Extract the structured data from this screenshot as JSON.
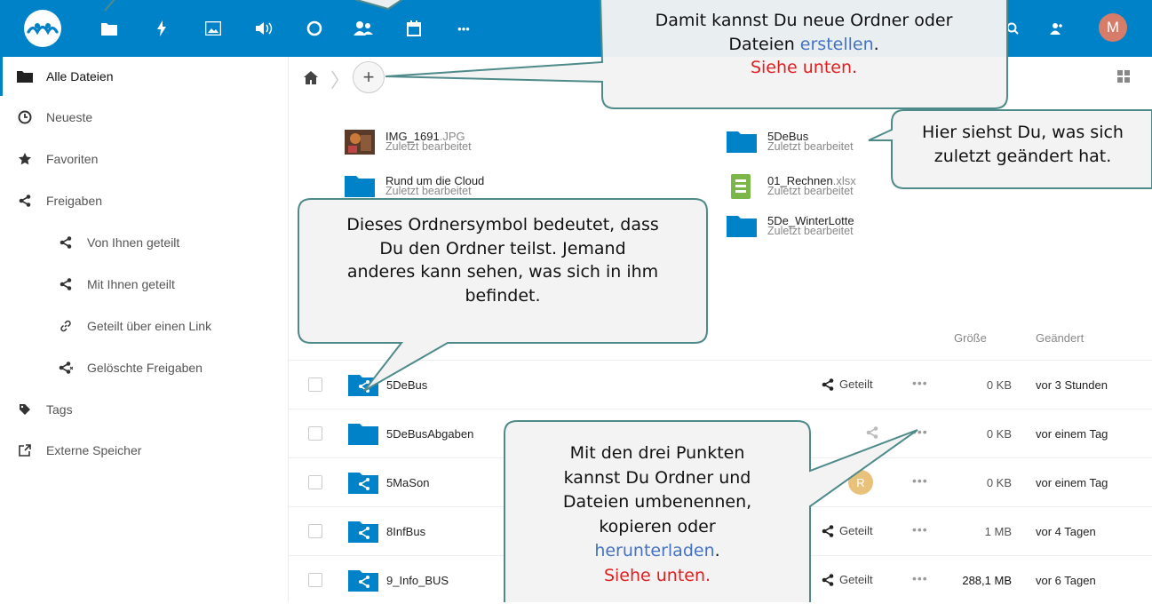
{
  "header": {
    "avatar_letter": "M",
    "brand_color": "#0082c9",
    "apps": [
      "files-icon",
      "activity-icon",
      "photos-icon",
      "audio-icon",
      "talk-icon",
      "contacts-icon",
      "calendar-icon",
      "more-apps-icon"
    ],
    "right_icons": [
      "search-icon",
      "contacts-menu-icon"
    ]
  },
  "sidebar": {
    "items": [
      {
        "label": "Alle Dateien",
        "icon": "folder-icon",
        "active": true
      },
      {
        "label": "Neueste",
        "icon": "clock-icon"
      },
      {
        "label": "Favoriten",
        "icon": "star-icon"
      },
      {
        "label": "Freigaben",
        "icon": "share-icon"
      },
      {
        "label": "Von Ihnen geteilt",
        "icon": "share-icon",
        "sub": true
      },
      {
        "label": "Mit Ihnen geteilt",
        "icon": "share-icon",
        "sub": true
      },
      {
        "label": "Geteilt über einen Link",
        "icon": "link-icon",
        "sub": true
      },
      {
        "label": "Gelöschte Freigaben",
        "icon": "share-deleted-icon",
        "sub": true
      },
      {
        "label": "Tags",
        "icon": "tag-icon"
      },
      {
        "label": "Externe Speicher",
        "icon": "external-icon"
      }
    ]
  },
  "recent": {
    "items": [
      {
        "name": "IMG_1691",
        "ext": ".JPG",
        "sub": "Zuletzt bearbeitet",
        "icon": "image-thumb-icon"
      },
      {
        "name": "Rund um die Cloud",
        "ext": "",
        "sub": "Zuletzt bearbeitet",
        "icon": "folder-icon"
      },
      {
        "name": "5DeBus",
        "ext": "",
        "sub": "Zuletzt bearbeitet",
        "icon": "folder-icon"
      },
      {
        "name": "01_Rechnen",
        "ext": ".xlsx",
        "sub": "Zuletzt bearbeitet",
        "icon": "spreadsheet-icon"
      },
      {
        "name": "5De_WinterLotte",
        "ext": "",
        "sub": "Zuletzt bearbeitet",
        "icon": "folder-icon"
      }
    ]
  },
  "columns": {
    "size": "Größe",
    "modified": "Geändert"
  },
  "files": [
    {
      "name": "5DeBus",
      "share": "Geteilt",
      "size": "0 KB",
      "modified": "vor 3 Stunden",
      "shared": true
    },
    {
      "name": "5DeBusAbgaben",
      "share": "",
      "size": "0 KB",
      "modified": "vor einem Tag",
      "shared": false
    },
    {
      "name": "5MaSon",
      "share": "",
      "size": "0 KB",
      "modified": "vor einem Tag",
      "shared": true,
      "avatar": "R"
    },
    {
      "name": "8InfBus",
      "share": "Geteilt",
      "size": "1 MB",
      "modified": "vor 4 Tagen",
      "shared": true
    },
    {
      "name": "9_Info_BUS",
      "share": "Geteilt",
      "size": "288,1 MB",
      "modified": "vor 6 Tagen",
      "shared": true
    }
  ],
  "callouts": {
    "create": {
      "line1": "Damit kannst Du neue Ordner oder",
      "line2a": "Dateien ",
      "line2b": "erstellen",
      "line2c": ".",
      "line3": "Siehe unten."
    },
    "recent": {
      "line1": "Hier siehst Du, was sich",
      "line2": "zuletzt geändert hat."
    },
    "shared": {
      "line1": "Dieses Ordnersymbol bedeutet, dass",
      "line2": "Du den Ordner teilst. Jemand",
      "line3": "anderes kann sehen, was sich in ihm",
      "line4": "befindet."
    },
    "dots": {
      "line1": "Mit den drei Punkten",
      "line2": "kannst Du Ordner und",
      "line3": "Dateien umbenennen,",
      "line4": "kopieren oder",
      "line5a": "herunterladen",
      "line5b": ".",
      "line6": "Siehe unten."
    }
  }
}
